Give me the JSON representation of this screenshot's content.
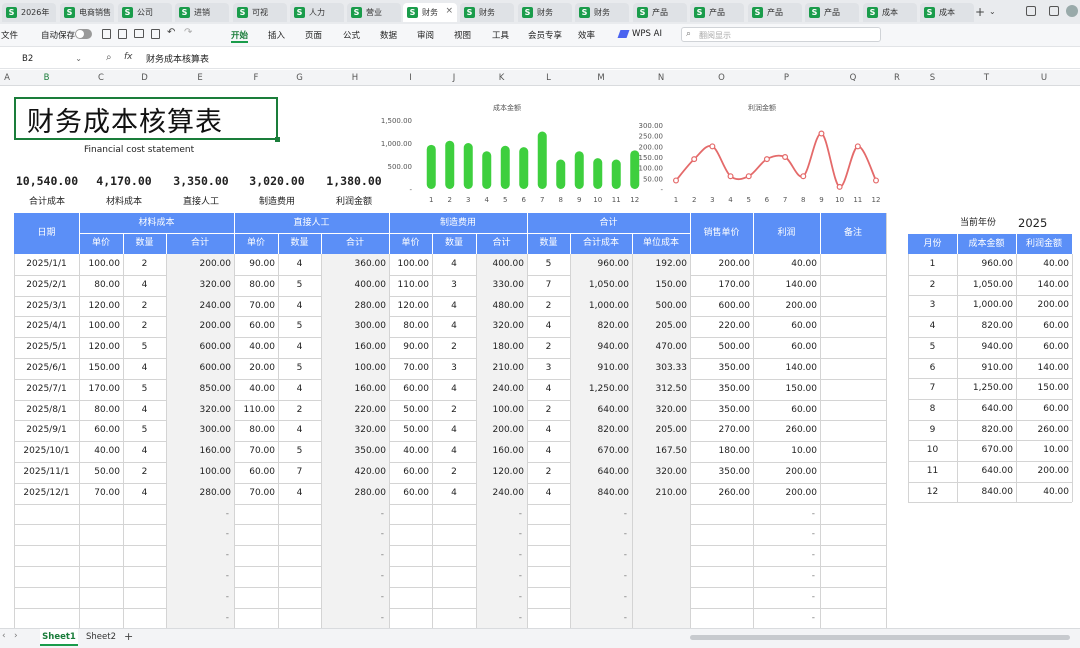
{
  "tabs": [
    {
      "label": "2026年",
      "active": false
    },
    {
      "label": "电商销售",
      "active": false
    },
    {
      "label": "公司",
      "active": false
    },
    {
      "label": "进销",
      "active": false
    },
    {
      "label": "可视",
      "active": false
    },
    {
      "label": "人力",
      "active": false
    },
    {
      "label": "营业",
      "active": false
    },
    {
      "label": "财务",
      "active": true
    },
    {
      "label": "财务",
      "active": false
    },
    {
      "label": "财务",
      "active": false
    },
    {
      "label": "财务",
      "active": false
    },
    {
      "label": "产品",
      "active": false
    },
    {
      "label": "产品",
      "active": false
    },
    {
      "label": "产品",
      "active": false
    },
    {
      "label": "产品",
      "active": false
    },
    {
      "label": "成本",
      "active": false
    },
    {
      "label": "成本",
      "active": false
    }
  ],
  "toolbar": {
    "file": "文件",
    "autosave": "自动保存",
    "menus": [
      "开始",
      "插入",
      "页面",
      "公式",
      "数据",
      "审阅",
      "视图",
      "工具",
      "会员专享",
      "效率"
    ],
    "wps_ai": "WPS AI",
    "search_placeholder": "翻阅显示"
  },
  "formula": {
    "cell_ref": "B2",
    "fx": "fx",
    "content": "财务成本核算表"
  },
  "columns": [
    "A",
    "B",
    "C",
    "D",
    "E",
    "F",
    "G",
    "H",
    "I",
    "J",
    "K",
    "L",
    "M",
    "N",
    "O",
    "P",
    "Q",
    "R",
    "S",
    "T",
    "U"
  ],
  "title": "财务成本核算表",
  "subtitle": "Financial cost statement",
  "summary": [
    {
      "value": "10,540.00",
      "label": "合计成本"
    },
    {
      "value": "4,170.00",
      "label": "材料成本"
    },
    {
      "value": "3,350.00",
      "label": "直接人工"
    },
    {
      "value": "3,020.00",
      "label": "制造费用"
    },
    {
      "value": "1,380.00",
      "label": "利润金额"
    }
  ],
  "table": {
    "groups": {
      "date": "日期",
      "material": "材料成本",
      "labor": "直接人工",
      "mfg": "制造费用",
      "total": "合计",
      "price": "销售单价",
      "profit": "利润",
      "note": "备注"
    },
    "sub": {
      "unit": "单价",
      "qty": "数量",
      "sum": "合计",
      "total_cost": "合计成本",
      "unit_cost": "单位成本"
    },
    "rows": [
      [
        "2025/1/1",
        "100.00",
        "2",
        "200.00",
        "90.00",
        "4",
        "360.00",
        "100.00",
        "4",
        "400.00",
        "5",
        "960.00",
        "192.00",
        "200.00",
        "40.00"
      ],
      [
        "2025/2/1",
        "80.00",
        "4",
        "320.00",
        "80.00",
        "5",
        "400.00",
        "110.00",
        "3",
        "330.00",
        "7",
        "1,050.00",
        "150.00",
        "170.00",
        "140.00"
      ],
      [
        "2025/3/1",
        "120.00",
        "2",
        "240.00",
        "70.00",
        "4",
        "280.00",
        "120.00",
        "4",
        "480.00",
        "2",
        "1,000.00",
        "500.00",
        "600.00",
        "200.00"
      ],
      [
        "2025/4/1",
        "100.00",
        "2",
        "200.00",
        "60.00",
        "5",
        "300.00",
        "80.00",
        "4",
        "320.00",
        "4",
        "820.00",
        "205.00",
        "220.00",
        "60.00"
      ],
      [
        "2025/5/1",
        "120.00",
        "5",
        "600.00",
        "40.00",
        "4",
        "160.00",
        "90.00",
        "2",
        "180.00",
        "2",
        "940.00",
        "470.00",
        "500.00",
        "60.00"
      ],
      [
        "2025/6/1",
        "150.00",
        "4",
        "600.00",
        "20.00",
        "5",
        "100.00",
        "70.00",
        "3",
        "210.00",
        "3",
        "910.00",
        "303.33",
        "350.00",
        "140.00"
      ],
      [
        "2025/7/1",
        "170.00",
        "5",
        "850.00",
        "40.00",
        "4",
        "160.00",
        "60.00",
        "4",
        "240.00",
        "4",
        "1,250.00",
        "312.50",
        "350.00",
        "150.00"
      ],
      [
        "2025/8/1",
        "80.00",
        "4",
        "320.00",
        "110.00",
        "2",
        "220.00",
        "50.00",
        "2",
        "100.00",
        "2",
        "640.00",
        "320.00",
        "350.00",
        "60.00"
      ],
      [
        "2025/9/1",
        "60.00",
        "5",
        "300.00",
        "80.00",
        "4",
        "320.00",
        "50.00",
        "4",
        "200.00",
        "4",
        "820.00",
        "205.00",
        "270.00",
        "260.00"
      ],
      [
        "2025/10/1",
        "40.00",
        "4",
        "160.00",
        "70.00",
        "5",
        "350.00",
        "40.00",
        "4",
        "160.00",
        "4",
        "670.00",
        "167.50",
        "180.00",
        "10.00"
      ],
      [
        "2025/11/1",
        "50.00",
        "2",
        "100.00",
        "60.00",
        "7",
        "420.00",
        "60.00",
        "2",
        "120.00",
        "2",
        "640.00",
        "320.00",
        "350.00",
        "200.00"
      ],
      [
        "2025/12/1",
        "70.00",
        "4",
        "280.00",
        "70.00",
        "4",
        "280.00",
        "60.00",
        "4",
        "240.00",
        "4",
        "840.00",
        "210.00",
        "260.00",
        "200.00"
      ]
    ],
    "empty_mark": "-"
  },
  "side": {
    "year_label": "当前年份",
    "year": "2025",
    "headers": [
      "月份",
      "成本金额",
      "利润金额"
    ],
    "rows": [
      [
        "1",
        "960.00",
        "40.00"
      ],
      [
        "2",
        "1,050.00",
        "140.00"
      ],
      [
        "3",
        "1,000.00",
        "200.00"
      ],
      [
        "4",
        "820.00",
        "60.00"
      ],
      [
        "5",
        "940.00",
        "60.00"
      ],
      [
        "6",
        "910.00",
        "140.00"
      ],
      [
        "7",
        "1,250.00",
        "150.00"
      ],
      [
        "8",
        "640.00",
        "60.00"
      ],
      [
        "9",
        "820.00",
        "260.00"
      ],
      [
        "10",
        "670.00",
        "10.00"
      ],
      [
        "11",
        "640.00",
        "200.00"
      ],
      [
        "12",
        "840.00",
        "40.00"
      ]
    ]
  },
  "sheets": [
    "Sheet1",
    "Sheet2"
  ],
  "colors": {
    "header_blue": "#5b8ff7",
    "bar_green": "#3ecf3e",
    "line_red": "#e46a6a",
    "accent_green": "#1a9c4b"
  },
  "chart_data": [
    {
      "type": "bar",
      "title": "成本金额",
      "categories": [
        "1",
        "2",
        "3",
        "4",
        "5",
        "6",
        "7",
        "8",
        "9",
        "10",
        "11",
        "12"
      ],
      "values": [
        960,
        1050,
        1000,
        820,
        940,
        910,
        1250,
        640,
        820,
        670,
        640,
        840
      ],
      "yticks": [
        "-",
        "500.00",
        "1,000.00",
        "1,500.00"
      ],
      "ylim": [
        0,
        1500
      ],
      "grid": false
    },
    {
      "type": "line",
      "title": "利润金额",
      "categories": [
        "1",
        "2",
        "3",
        "4",
        "5",
        "6",
        "7",
        "8",
        "9",
        "10",
        "11",
        "12"
      ],
      "values": [
        40,
        140,
        200,
        60,
        60,
        140,
        150,
        60,
        260,
        10,
        200,
        40
      ],
      "yticks": [
        "-",
        "50.00",
        "100.00",
        "150.00",
        "200.00",
        "250.00",
        "300.00"
      ],
      "ylim": [
        0,
        300
      ],
      "grid": false
    }
  ]
}
